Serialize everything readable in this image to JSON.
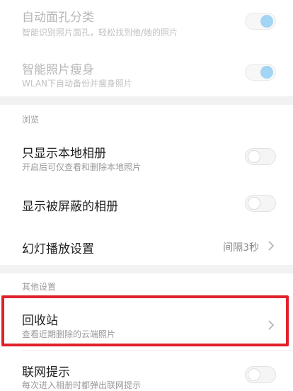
{
  "smart_section": {
    "items": [
      {
        "title": "自动面孔分类",
        "subtitle": "智能识别照片面孔，轻松找到他/她的照片",
        "toggle": "on",
        "enabled": false
      },
      {
        "title": "智能照片瘦身",
        "subtitle": "WLAN下自动备份并瘦身照片",
        "toggle": "on",
        "enabled": false
      }
    ]
  },
  "browse_section": {
    "header": "浏览",
    "items": [
      {
        "title": "只显示本地相册",
        "subtitle": "开启后可仅查看和删除本地照片",
        "toggle": "off"
      },
      {
        "title": "显示被屏蔽的相册",
        "toggle": "off"
      },
      {
        "title": "幻灯播放设置",
        "value": "间隔3秒"
      }
    ]
  },
  "other_section": {
    "header": "其他设置",
    "items": [
      {
        "title": "回收站",
        "subtitle": "查看近期删除的云端照片"
      },
      {
        "title": "联网提示",
        "subtitle": "每次进入相册时都弹出联网提示",
        "toggle": "off"
      }
    ]
  },
  "colors": {
    "toggle_on": "#82c8ef",
    "highlight_border": "#e1212a",
    "section_background": "#f2f2f2"
  }
}
